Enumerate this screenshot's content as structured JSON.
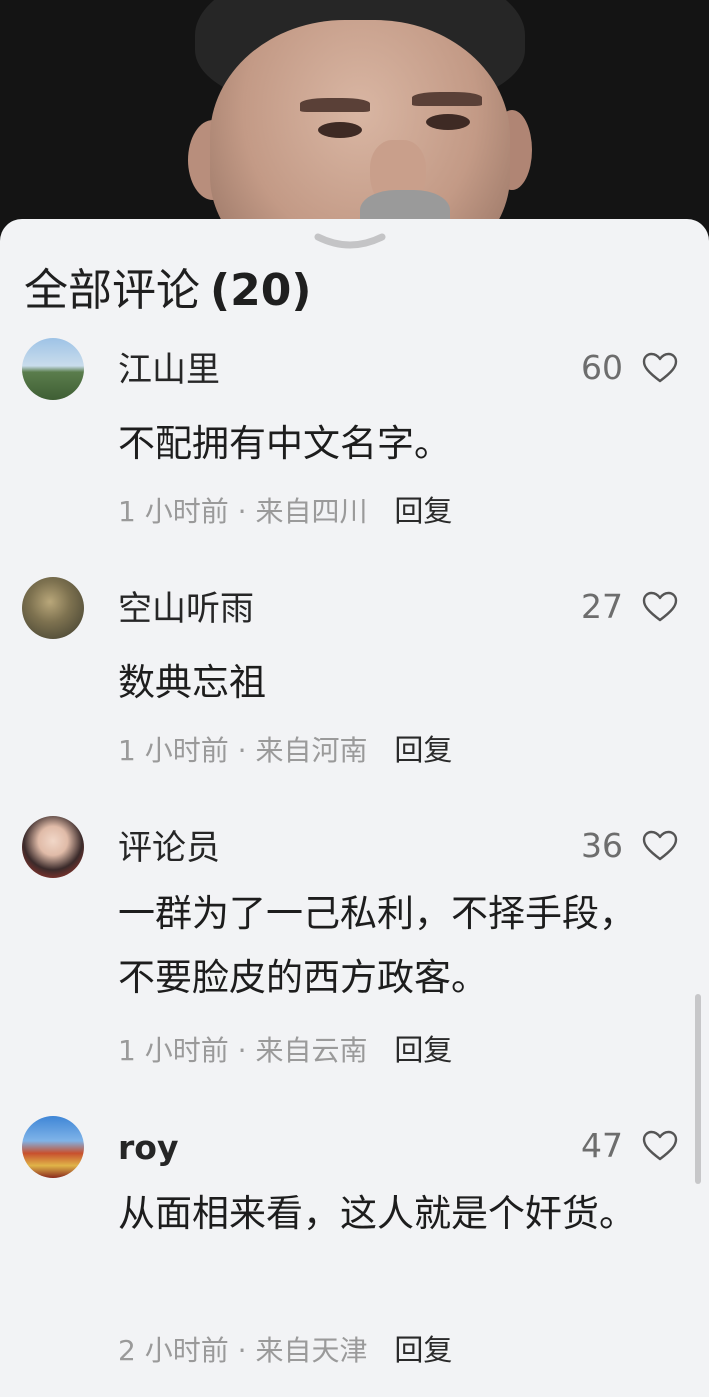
{
  "header": {
    "title": "全部评论",
    "count": "(20)"
  },
  "icons": {
    "collapse": "chevron-down-icon",
    "like": "heart-outline-icon"
  },
  "comments": [
    {
      "username": "江山里",
      "text": "不配拥有中文名字。",
      "time": "1 小时前",
      "separator": "·",
      "location": "来自四川",
      "reply_label": "回复",
      "likes": "60"
    },
    {
      "username": "空山听雨",
      "text": "数典忘祖",
      "time": "1 小时前",
      "separator": "·",
      "location": "来自河南",
      "reply_label": "回复",
      "likes": "27"
    },
    {
      "username": "评论员",
      "text": "一群为了一己私利，不择手段，不要脸皮的西方政客。",
      "time": "1 小时前",
      "separator": "·",
      "location": "来自云南",
      "reply_label": "回复",
      "likes": "36"
    },
    {
      "username": "roy",
      "text": "从面相来看，这人就是个奸货。",
      "time": "2 小时前",
      "separator": "·",
      "location": "来自天津",
      "reply_label": "回复",
      "likes": "47"
    }
  ]
}
